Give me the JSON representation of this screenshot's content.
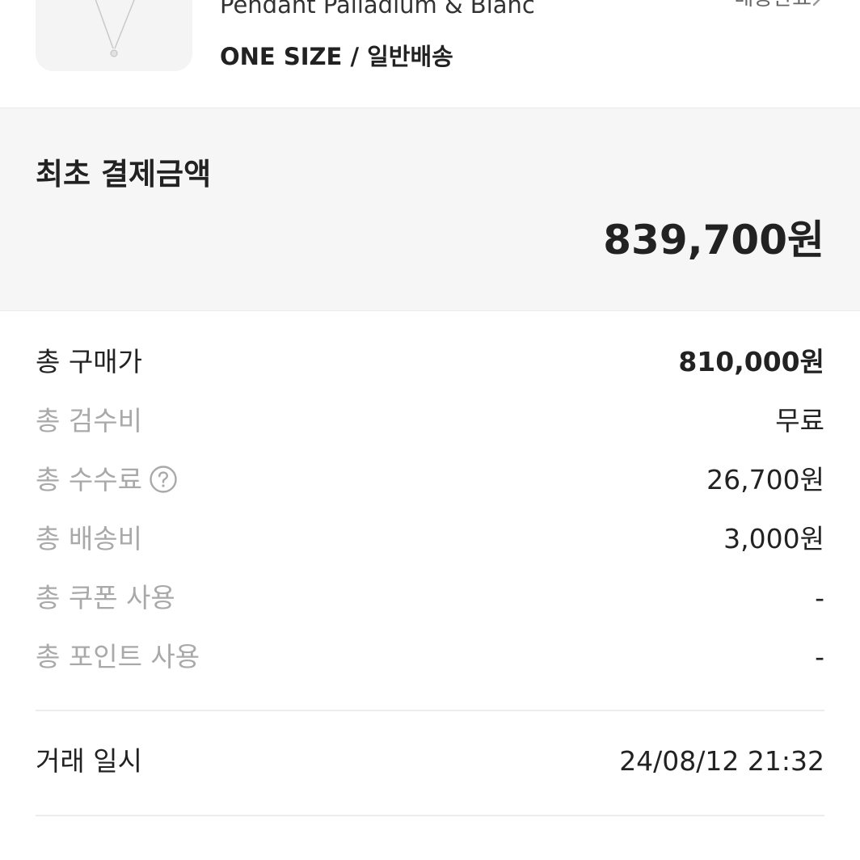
{
  "product": {
    "image_alt": "necklace-thumbnail",
    "name": "Pendant Palladium & Blanc",
    "option": "ONE SIZE / 일반배송",
    "header_link": "배송완료"
  },
  "payment": {
    "title": "최초 결제금액",
    "amount": "839,700원"
  },
  "breakdown": [
    {
      "label": "총 구매가",
      "value": "810,000원"
    },
    {
      "label": "총 검수비",
      "value": "무료"
    },
    {
      "label": "총 수수료",
      "value": "26,700원"
    },
    {
      "label": "총 배송비",
      "value": "3,000원"
    },
    {
      "label": "총 쿠폰 사용",
      "value": "-"
    },
    {
      "label": "총 포인트 사용",
      "value": "-"
    }
  ],
  "trade": {
    "label": "거래 일시",
    "value": "24/08/12 21:32"
  },
  "colors": {
    "text_primary": "#222222",
    "text_secondary": "#a9a9a9",
    "panel_bg": "#f6f6f6",
    "divider": "#ececec"
  },
  "icons": {
    "help": "question-circle-icon",
    "chevron": "chevron-right-icon"
  }
}
